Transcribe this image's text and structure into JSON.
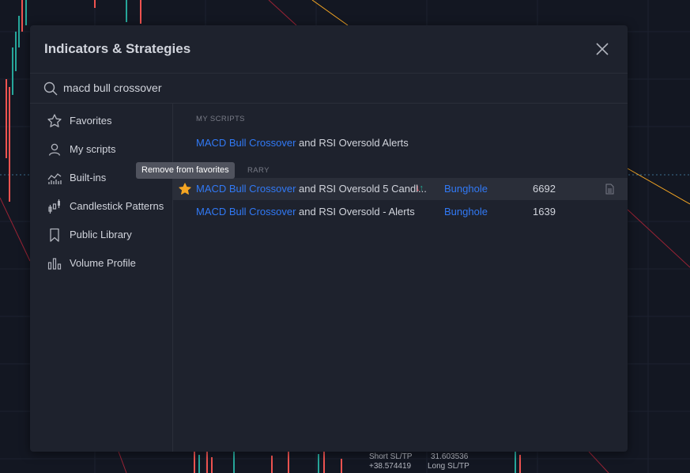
{
  "dialog": {
    "title": "Indicators & Strategies",
    "close_icon": "close-icon"
  },
  "search": {
    "value": "macd bull crossover",
    "icon": "search-icon"
  },
  "sidebar": {
    "items": [
      {
        "label": "Favorites",
        "icon": "star-outline-icon"
      },
      {
        "label": "My scripts",
        "icon": "user-icon"
      },
      {
        "label": "Built-ins",
        "icon": "built-ins-chart-icon"
      },
      {
        "label": "Candlestick Patterns",
        "icon": "candlestick-icon"
      },
      {
        "label": "Public Library",
        "icon": "bookmark-icon"
      },
      {
        "label": "Volume Profile",
        "icon": "volume-profile-icon"
      }
    ]
  },
  "results": {
    "my_scripts": {
      "header": "MY SCRIPTS",
      "rows": [
        {
          "match": "MACD Bull Crossover",
          "rest": " and RSI Oversold Alerts"
        }
      ]
    },
    "public_library": {
      "header_visible": "RARY",
      "rows": [
        {
          "match": "MACD Bull Crossover",
          "rest": " and RSI Oversold 5 Candl...",
          "author": "Bunghole",
          "likes": "6692",
          "favorite": true,
          "updown": "↓↑"
        },
        {
          "match": "MACD Bull Crossover",
          "rest": " and RSI Oversold - Alerts",
          "author": "Bunghole",
          "likes": "1639",
          "favorite": false
        }
      ]
    }
  },
  "tooltip": {
    "text": "Remove from favorites"
  },
  "chart_overlay": {
    "short_label": "Short SL/TP",
    "short_value": "+38.574419",
    "long_value": "31.603536",
    "long_label": "Long SL/TP"
  },
  "colors": {
    "background": "#131722",
    "dialog": "#1e222d",
    "accent_blue": "#3179f5",
    "text": "#d1d4dc",
    "muted": "#787b86",
    "highlight_row": "#2a2e39",
    "star": "#f6a623"
  }
}
